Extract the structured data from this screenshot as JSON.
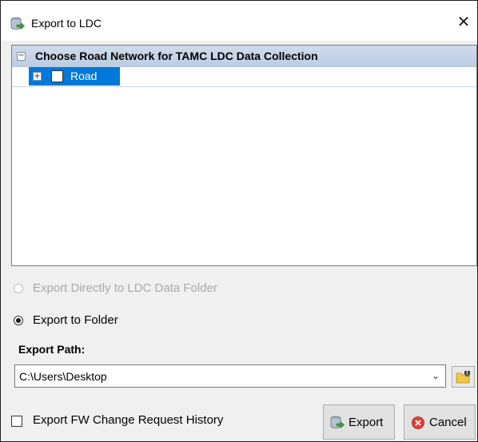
{
  "window": {
    "title": "Export to LDC",
    "close_glyph": "✕"
  },
  "tree": {
    "header_label": "Choose Road Network for TAMC LDC Data Collection",
    "collapse_glyph": "−",
    "items": [
      {
        "label": "Road",
        "checked": false,
        "expand_glyph": "+"
      }
    ]
  },
  "options": {
    "direct_label": "Export Directly to LDC Data Folder",
    "folder_label": "Export to Folder"
  },
  "export_path": {
    "label": "Export Path:",
    "value": "C:\\Users\\Desktop",
    "arrow_glyph": "⌄"
  },
  "history_checkbox": {
    "label": "Export FW Change Request History",
    "checked": false
  },
  "buttons": {
    "export_label": "Export",
    "cancel_label": "Cancel"
  },
  "icons": {
    "title": "database-export-icon",
    "browse": "folder-browse-icon",
    "export": "database-export-icon",
    "cancel": "cancel-circle-icon"
  },
  "colors": {
    "selection": "#0078d7",
    "header_band": "#bccde3",
    "cancel_red": "#e0413a",
    "folder_yellow": "#f3c74a"
  }
}
